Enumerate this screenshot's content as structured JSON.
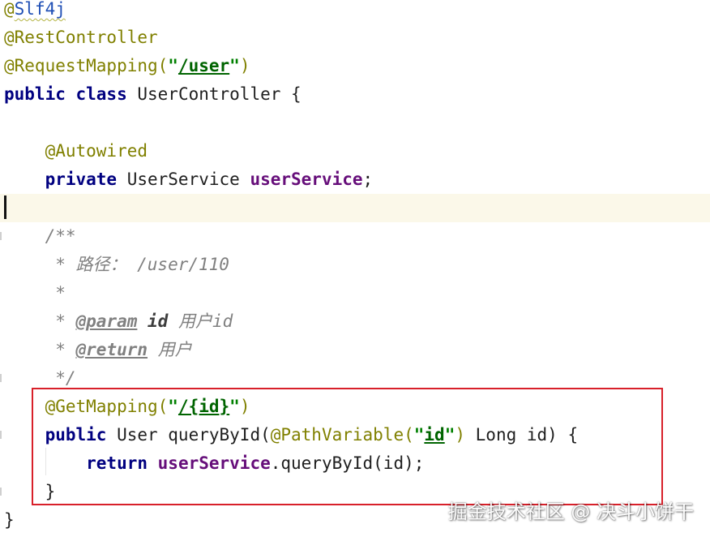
{
  "code": {
    "lines": [
      {
        "segments": [
          {
            "text": "@",
            "cls": "anno"
          },
          {
            "text": "Slf4j",
            "cls": "link squiggle"
          }
        ]
      },
      {
        "segments": [
          {
            "text": "@RestController",
            "cls": "anno"
          }
        ]
      },
      {
        "segments": [
          {
            "text": "@RequestMapping(",
            "cls": "anno"
          },
          {
            "text": "\"",
            "cls": "str"
          },
          {
            "text": "/user",
            "cls": "strlink"
          },
          {
            "text": "\"",
            "cls": "str"
          },
          {
            "text": ")",
            "cls": "anno"
          }
        ]
      },
      {
        "segments": [
          {
            "text": "public class ",
            "cls": "kw"
          },
          {
            "text": "UserController {",
            "cls": ""
          }
        ]
      },
      {
        "segments": []
      },
      {
        "segments": [
          {
            "text": "    @Autowired",
            "cls": "anno"
          }
        ]
      },
      {
        "segments": [
          {
            "text": "    private ",
            "cls": "kw"
          },
          {
            "text": "UserService ",
            "cls": ""
          },
          {
            "text": "userService",
            "cls": "field"
          },
          {
            "text": ";",
            "cls": ""
          }
        ]
      },
      {
        "segments": []
      },
      {
        "segments": [
          {
            "text": "    /**",
            "cls": "doc"
          }
        ]
      },
      {
        "segments": [
          {
            "text": "     * 路径： /user/110",
            "cls": "doc"
          }
        ]
      },
      {
        "segments": [
          {
            "text": "     *",
            "cls": "doc"
          }
        ]
      },
      {
        "segments": [
          {
            "text": "     * ",
            "cls": "doc"
          },
          {
            "text": "@param",
            "cls": "doctag"
          },
          {
            "text": " ",
            "cls": "doc"
          },
          {
            "text": "id",
            "cls": "docparam"
          },
          {
            "text": " 用户id",
            "cls": "doc"
          }
        ]
      },
      {
        "segments": [
          {
            "text": "     * ",
            "cls": "doc"
          },
          {
            "text": "@return",
            "cls": "doctag"
          },
          {
            "text": " 用户",
            "cls": "doc"
          }
        ]
      },
      {
        "segments": [
          {
            "text": "     */",
            "cls": "doc"
          }
        ]
      },
      {
        "segments": [
          {
            "text": "    @GetMapping(",
            "cls": "anno"
          },
          {
            "text": "\"",
            "cls": "str"
          },
          {
            "text": "/{id}",
            "cls": "strlink"
          },
          {
            "text": "\"",
            "cls": "str"
          },
          {
            "text": ")",
            "cls": "anno"
          }
        ]
      },
      {
        "segments": [
          {
            "text": "    public ",
            "cls": "kw"
          },
          {
            "text": "User queryById(",
            "cls": ""
          },
          {
            "text": "@PathVariable(",
            "cls": "anno"
          },
          {
            "text": "\"",
            "cls": "str"
          },
          {
            "text": "id",
            "cls": "strlink"
          },
          {
            "text": "\"",
            "cls": "str"
          },
          {
            "text": ") ",
            "cls": "anno"
          },
          {
            "text": "Long id) {",
            "cls": ""
          }
        ]
      },
      {
        "segments": [
          {
            "text": "        return ",
            "cls": "kw"
          },
          {
            "text": "userService",
            "cls": "field"
          },
          {
            "text": ".queryById(id);",
            "cls": ""
          }
        ]
      },
      {
        "segments": [
          {
            "text": "    }",
            "cls": ""
          }
        ]
      },
      {
        "segments": [
          {
            "text": "}",
            "cls": ""
          }
        ]
      }
    ]
  },
  "watermark": "掘金技术社区 @ 决斗小饼干"
}
